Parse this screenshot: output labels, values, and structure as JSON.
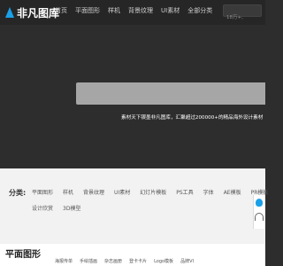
{
  "header": {
    "logo_text": "非凡图库",
    "nav": [
      "首页",
      "平面图形",
      "样机",
      "背景纹理",
      "UI素材",
      "全部分类"
    ],
    "search_placeholder": "18万+,"
  },
  "hero": {
    "tagline": "素材天下锲墨非凡图库，汇聚超过200000+的精品海外设计素材"
  },
  "categories": {
    "label": "分类:",
    "row1": [
      "平面图形",
      "样机",
      "背景纹理",
      "UI素材",
      "幻灯片模板",
      "PS工具",
      "字体",
      "AE模板",
      "PR模板"
    ],
    "row2": [
      "设计欣赏",
      "3D模型"
    ]
  },
  "section": {
    "title": "平面图形",
    "subtabs": [
      "海报传单",
      "手绘插画",
      "杂志画册",
      "登卡卡片",
      "Logo模板",
      "品牌VI"
    ]
  },
  "colors": {
    "accent": "#1aa0e8",
    "background": "#2d2d2d"
  }
}
